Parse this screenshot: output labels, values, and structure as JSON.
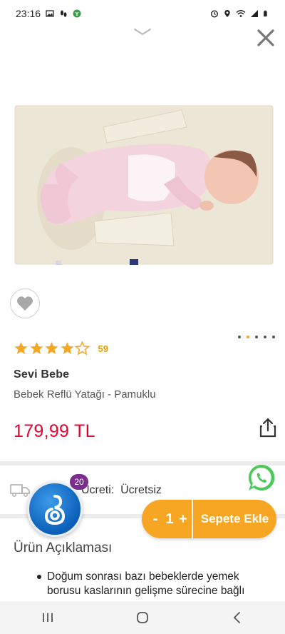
{
  "status": {
    "time": "23:16"
  },
  "product": {
    "rating_stars": 4,
    "rating_count": "59",
    "brand": "Sevi Bebe",
    "name": "Bebek Reflü Yatağı - Pamuklu",
    "price": "179,99 TL"
  },
  "carousel": {
    "total_dots": 5,
    "active_index": 1
  },
  "shipping": {
    "label": "Ücreti:",
    "value": "Ücretsiz"
  },
  "logo_badge": "20",
  "cart": {
    "minus": "-",
    "quantity": "1",
    "plus": "+",
    "add_label": "Sepete Ekle"
  },
  "description": {
    "title": "Ürün Açıklaması",
    "bullet_1": "Doğum sonrası bazı bebeklerde yemek borusu kaslarının gelişme sürecine bağlı"
  },
  "colors": {
    "price": "#e4032e",
    "accent": "#f6a623",
    "star": "#f5a623",
    "whatsapp": "#4ac959",
    "badge": "#7b2d8e"
  }
}
